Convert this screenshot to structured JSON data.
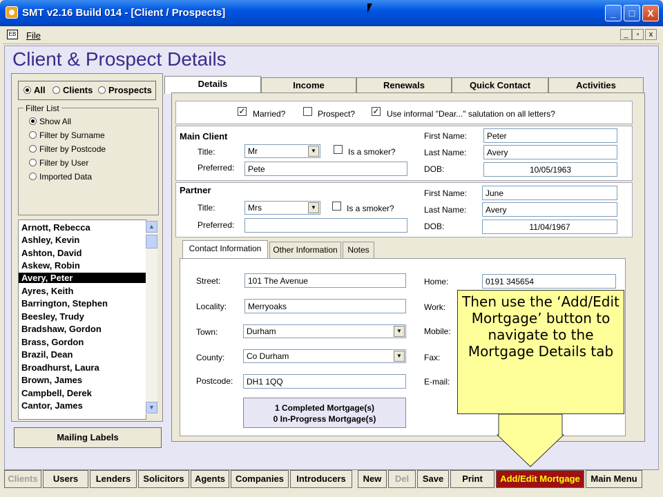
{
  "window": {
    "title": "SMT v2.16 Build 014 - [Client / Prospects]",
    "min": "_",
    "max": "□",
    "close": "X"
  },
  "menu": {
    "file": "File",
    "mdi_min": "_",
    "mdi_restore": "▫",
    "mdi_close": "x",
    "icon_label": "EB"
  },
  "heading": "Client & Prospect Details",
  "filter_type": {
    "all": "All",
    "clients": "Clients",
    "prospects": "Prospects",
    "selected": "all"
  },
  "filter_list": {
    "legend": "Filter List",
    "options": [
      "Show All",
      "Filter by Surname",
      "Filter by Postcode",
      "Filter by User",
      "Imported Data"
    ],
    "selected": 0
  },
  "clients": [
    "Arnott, Rebecca",
    "Ashley, Kevin",
    "Ashton, David",
    "Askew, Robin",
    "Avery, Peter",
    "Ayres, Keith",
    "Barrington, Stephen",
    "Beesley, Trudy",
    "Bradshaw, Gordon",
    "Brass, Gordon",
    "Brazil, Dean",
    "Broadhurst, Laura",
    "Brown, James",
    "Campbell, Derek",
    "Cantor, James"
  ],
  "selected_client": 4,
  "scroll": {
    "up": "▲",
    "down": "▼"
  },
  "mailing_labels": "Mailing Labels",
  "tabs": [
    "Details",
    "Income",
    "Renewals",
    "Quick Contact",
    "Activities"
  ],
  "options": {
    "married": "Married?",
    "prospect": "Prospect?",
    "informal": "Use informal \"Dear...\" salutation on all letters?",
    "married_checked": "✓",
    "prospect_checked": "",
    "informal_checked": "✓"
  },
  "main_client": {
    "header": "Main Client",
    "title_label": "Title:",
    "title": "Mr",
    "smoker": "Is a smoker?",
    "preferred_label": "Preferred:",
    "preferred": "Pete",
    "first_label": "First Name:",
    "first": "Peter",
    "last_label": "Last Name:",
    "last": "Avery",
    "dob_label": "DOB:",
    "dob": "10/05/1963"
  },
  "partner": {
    "header": "Partner",
    "title_label": "Title:",
    "title": "Mrs",
    "smoker": "Is a smoker?",
    "preferred_label": "Preferred:",
    "preferred": "",
    "first_label": "First Name:",
    "first": "June",
    "last_label": "Last Name:",
    "last": "Avery",
    "dob_label": "DOB:",
    "dob": "11/04/1967"
  },
  "inner_tabs": [
    "Contact Information",
    "Other Information",
    "Notes"
  ],
  "contact": {
    "street_label": "Street:",
    "street": "101 The Avenue",
    "locality_label": "Locality:",
    "locality": "Merryoaks",
    "town_label": "Town:",
    "town": "Durham",
    "county_label": "County:",
    "county": "Co Durham",
    "postcode_label": "Postcode:",
    "postcode": "DH1 1QQ",
    "home_label": "Home:",
    "home": "0191 345654",
    "work_label": "Work:",
    "mobile_label": "Mobile:",
    "fax_label": "Fax:",
    "email_label": "E-mail:"
  },
  "mortgages": {
    "completed": "1 Completed Mortgage(s)",
    "in_progress": "0 In-Progress Mortgage(s)"
  },
  "callout": "Then use the ‘Add/Edit Mortgage’ button to navigate to the Mortgage Details tab",
  "combo_arrow": "▼",
  "bottom": {
    "clients": "Clients",
    "users": "Users",
    "lenders": "Lenders",
    "solicitors": "Solicitors",
    "agents": "Agents",
    "companies": "Companies",
    "introducers": "Introducers",
    "new": "New",
    "del": "Del",
    "save": "Save",
    "print": "Print",
    "add_edit": "Add/Edit Mortgage",
    "main_menu": "Main Menu"
  },
  "colors": {
    "heading": "#3a2a8c",
    "callout": "#ffff99",
    "add_edit_bg": "#a01010",
    "add_edit_fg": "#ffff00"
  }
}
